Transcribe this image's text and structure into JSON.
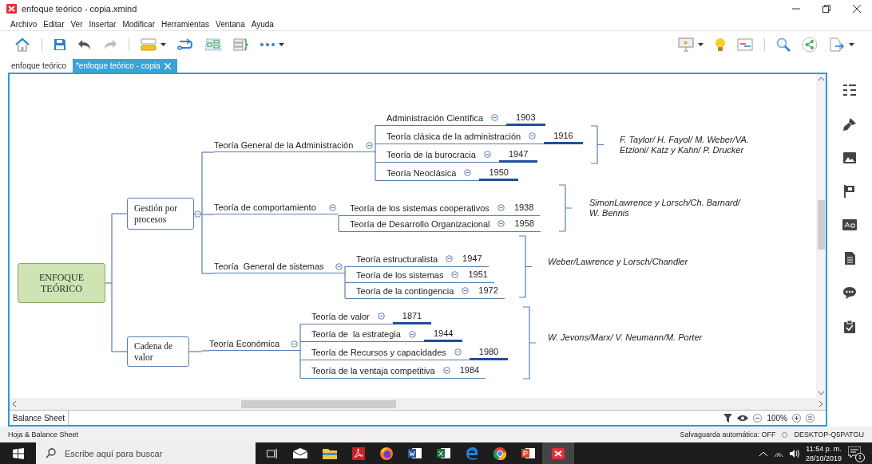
{
  "window": {
    "title": "enfoque teórico - copia.xmind"
  },
  "menu": [
    "Archivo",
    "Editar",
    "Ver",
    "Insertar",
    "Modificar",
    "Herramientas",
    "Ventana",
    "Ayuda"
  ],
  "tabs": [
    {
      "label": "enfoque teórico",
      "selected": false
    },
    {
      "label": "*enfoque teórico - copia",
      "selected": true
    }
  ],
  "map": {
    "central": "ENFOQUE TEÓRICO",
    "branches": [
      {
        "label": "Gestión por procesos",
        "subtopics": [
          {
            "label": "Teoría General de la Administración",
            "children": [
              {
                "label": "Administración Científica",
                "year": "1903",
                "underlined": true
              },
              {
                "label": "Teoría clásica de la administración",
                "year": "1916",
                "underlined": true
              },
              {
                "label": "Teoría de la burocracia",
                "year": "1947",
                "underlined": true
              },
              {
                "label": "Teoría Neoclásica",
                "year": "1950",
                "underlined": true
              }
            ]
          },
          {
            "label": "Teoría de comportamiento",
            "children": [
              {
                "label": "Teoría de los sistemas cooperativos",
                "year": "1938",
                "underlined": false
              },
              {
                "label": "Teoría de Desarrollo Organizacional",
                "year": "1958",
                "underlined": false
              }
            ]
          },
          {
            "label": "Teoría  General de sistemas",
            "children": [
              {
                "label": "Teoría estructuralista",
                "year": "1947",
                "underlined": false
              },
              {
                "label": "Teoría de los sistemas",
                "year": "1951",
                "underlined": false
              },
              {
                "label": "Teoría de la contingencia",
                "year": "1972",
                "underlined": false
              }
            ]
          }
        ]
      },
      {
        "label": "Cadena de valor",
        "subtopics": [
          {
            "label": "Teoría Económica",
            "children": [
              {
                "label": "Teoría de valor",
                "year": "1871",
                "underlined": true
              },
              {
                "label": "Teoría de  la estrategia",
                "year": "1944",
                "underlined": true
              },
              {
                "label": "Teoría de Recursos y capacidades",
                "year": "1980",
                "underlined": true
              },
              {
                "label": "Teoría de la ventaja competitiva",
                "year": "1984",
                "underlined": false
              }
            ]
          }
        ]
      }
    ],
    "summaries": [
      {
        "text": "F. Taylor/ H. Fayol/ M. Weber/VA. Etzioni/ Katz y Kahn/ P. Drucker"
      },
      {
        "text": "SimonLawrence y Lorsch/Ch. Barnard/ W. Bennis"
      },
      {
        "text": "Weber/Lawrence y Lorsch/Chandler"
      },
      {
        "text": "W. Jevons/Marx/ V. Neumann/M. Porter"
      }
    ]
  },
  "sheet_tab": "Balance Sheet",
  "zoom": "100%",
  "status_bar": {
    "left": "Hoja & Balance Sheet",
    "autosave": "Salvaguarda automática: OFF",
    "computer": "DESKTOP-Q5PATGU"
  },
  "taskbar": {
    "search_placeholder": "Escribe aquí para buscar",
    "time": "11:54 p. m.",
    "date": "28/10/2019",
    "notifications": "1"
  }
}
